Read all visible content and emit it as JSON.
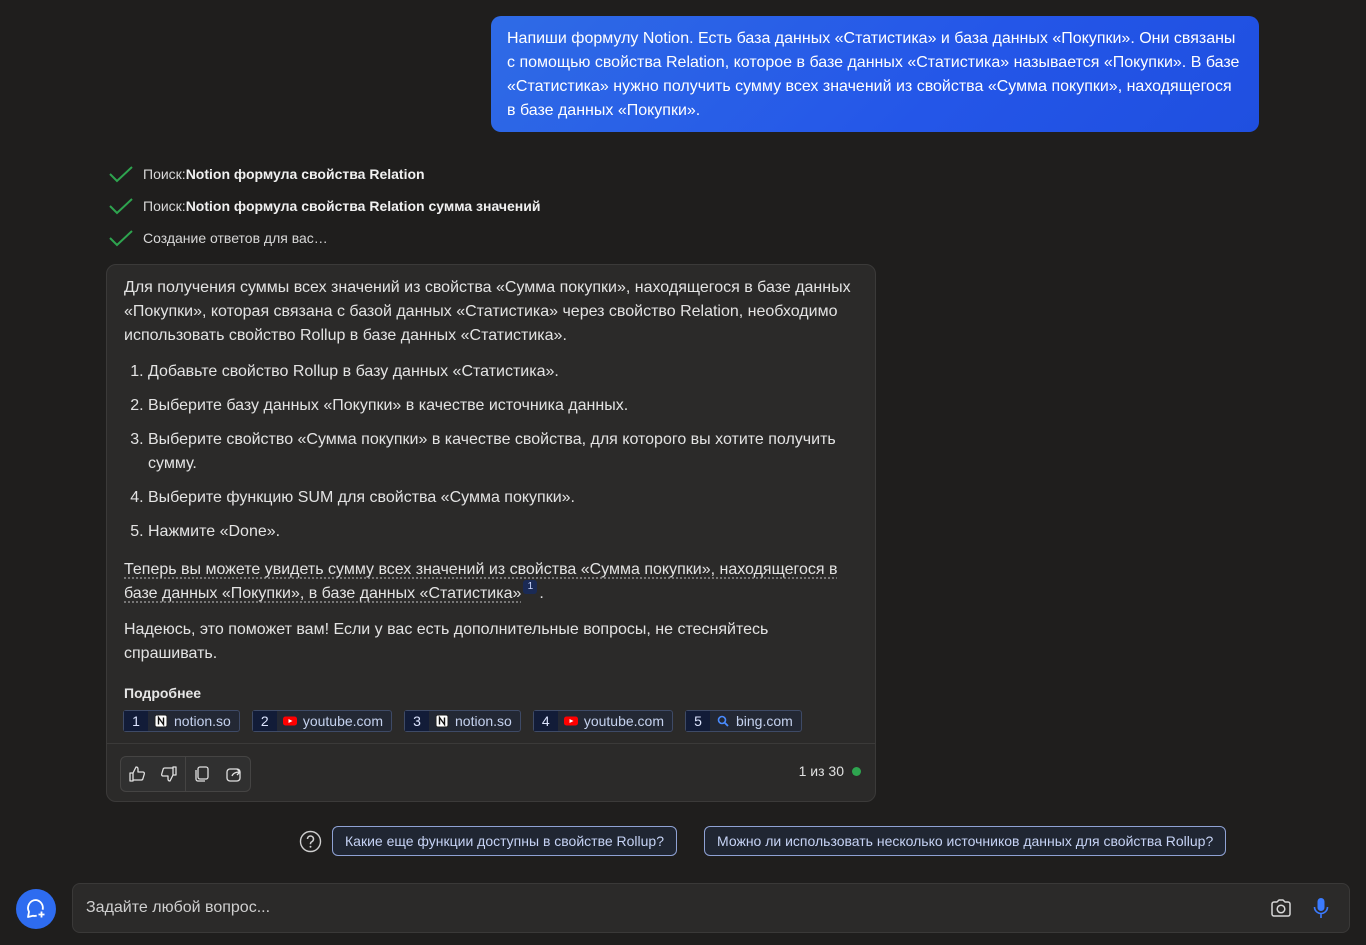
{
  "user_message": "Напиши формулу Notion. Есть база данных «Статистика» и база данных «Покупки». Они связаны с помощью свойства Relation, которое в базе данных «Статистика» называется «Покупки». В базе «Статистика» нужно получить сумму всех значений из свойства «Сумма покупки», находящегося в базе данных «Покупки».",
  "steps": [
    {
      "prefix": "Поиск: ",
      "bold": "Notion формула свойства Relation"
    },
    {
      "prefix": "Поиск: ",
      "bold": "Notion формула свойства Relation сумма значений"
    },
    {
      "prefix": "Создание ответов для вас…",
      "bold": ""
    }
  ],
  "answer": {
    "intro": "Для получения суммы всех значений из свойства «Сумма покупки», находящегося в базе данных «Покупки», которая связана с базой данных «Статистика» через свойство Relation, необходимо использовать свойство Rollup в базе данных «Статистика».",
    "list": [
      "Добавьте свойство Rollup в базу данных «Статистика».",
      "Выберите базу данных «Покупки» в качестве источника данных.",
      "Выберите свойство «Сумма покупки» в качестве свойства, для которого вы хотите получить сумму.",
      "Выберите функцию SUM для свойства «Сумма покупки».",
      "Нажмите «Done»."
    ],
    "cited_text": "Теперь вы можете увидеть сумму всех значений из свойства «Сумма покупки», находящегося в базе данных «Покупки», в базе данных «Статистика»",
    "citation": "1",
    "cited_tail": ".",
    "outro": "Надеюсь, это поможет вам! Если у вас есть дополнительные вопросы, не стесняйтесь спрашивать."
  },
  "more": {
    "title": "Подробнее",
    "sources": [
      {
        "num": "1",
        "domain": "notion.so",
        "icon": "notion-icon"
      },
      {
        "num": "2",
        "domain": "youtube.com",
        "icon": "youtube-icon"
      },
      {
        "num": "3",
        "domain": "notion.so",
        "icon": "notion-icon"
      },
      {
        "num": "4",
        "domain": "youtube.com",
        "icon": "youtube-icon"
      },
      {
        "num": "5",
        "domain": "bing.com",
        "icon": "search-icon"
      }
    ]
  },
  "counter": "1 из 30",
  "suggestions": [
    "Какие еще функции доступны в свойстве Rollup?",
    "Можно ли использовать несколько источников данных для свойства Rollup?"
  ],
  "input": {
    "placeholder": "Задайте любой вопрос..."
  },
  "colors": {
    "user_bubble": "#2456e8",
    "check": "#2ea44f",
    "status_dot": "#2ea44f",
    "fab": "#2e6cf0"
  }
}
